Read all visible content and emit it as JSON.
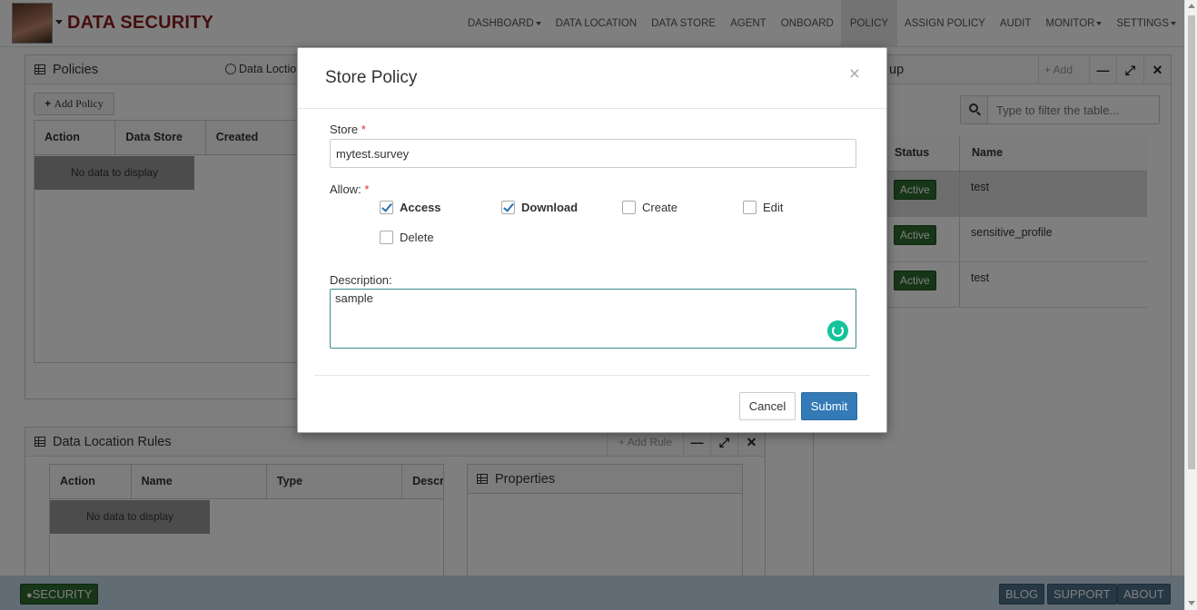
{
  "navbar": {
    "brand": "DATA SECURITY",
    "items": [
      {
        "label": "DASHBOARD",
        "dropdown": true
      },
      {
        "label": "DATA LOCATION",
        "dropdown": false
      },
      {
        "label": "DATA STORE",
        "dropdown": false
      },
      {
        "label": "AGENT",
        "dropdown": false
      },
      {
        "label": "ONBOARD",
        "dropdown": false
      },
      {
        "label": "POLICY",
        "dropdown": false,
        "active": true
      },
      {
        "label": "ASSIGN POLICY",
        "dropdown": false
      },
      {
        "label": "AUDIT",
        "dropdown": false
      },
      {
        "label": "MONITOR",
        "dropdown": true
      },
      {
        "label": "SETTINGS",
        "dropdown": true
      }
    ]
  },
  "policies_panel": {
    "title": "Policies",
    "data_location_link": "Data Loctio",
    "add_button": "Add Policy",
    "columns": [
      "Action",
      "Data Store",
      "Created"
    ],
    "empty_text": "No data to display"
  },
  "group_panel": {
    "title_suffix": "up",
    "add_button": "Add",
    "search_placeholder": "Type to filter the table...",
    "columns": [
      "Status",
      "Name"
    ],
    "rows": [
      {
        "status": "Active",
        "name": "test"
      },
      {
        "status": "Active",
        "name": "sensitive_profile"
      },
      {
        "status": "Active",
        "name": "test"
      }
    ]
  },
  "rules_panel": {
    "title": "Data Location Rules",
    "add_button": "Add Rule",
    "columns": [
      "Action",
      "Name",
      "Type",
      "Descr"
    ],
    "empty_text": "No data to display"
  },
  "properties_panel": {
    "title": "Properties"
  },
  "modal": {
    "title": "Store Policy",
    "close": "×",
    "store_label": "Store",
    "store_value": "mytest.survey",
    "allow_label": "Allow:",
    "required_mark": "*",
    "permissions": [
      {
        "label": "Access",
        "checked": true
      },
      {
        "label": "Download",
        "checked": true
      },
      {
        "label": "Create",
        "checked": false
      },
      {
        "label": "Edit",
        "checked": false
      },
      {
        "label": "Delete",
        "checked": false
      }
    ],
    "description_label": "Description:",
    "description_value": "sample",
    "cancel_label": "Cancel",
    "submit_label": "Submit"
  },
  "footer": {
    "security_label": "SECURITY",
    "links": [
      "BLOG",
      "SUPPORT",
      "ABOUT"
    ]
  },
  "colors": {
    "brand": "#8b1c1c",
    "primary": "#337ab7",
    "active_badge": "#2e6b2e",
    "footer_bg": "#c5d8e8"
  }
}
